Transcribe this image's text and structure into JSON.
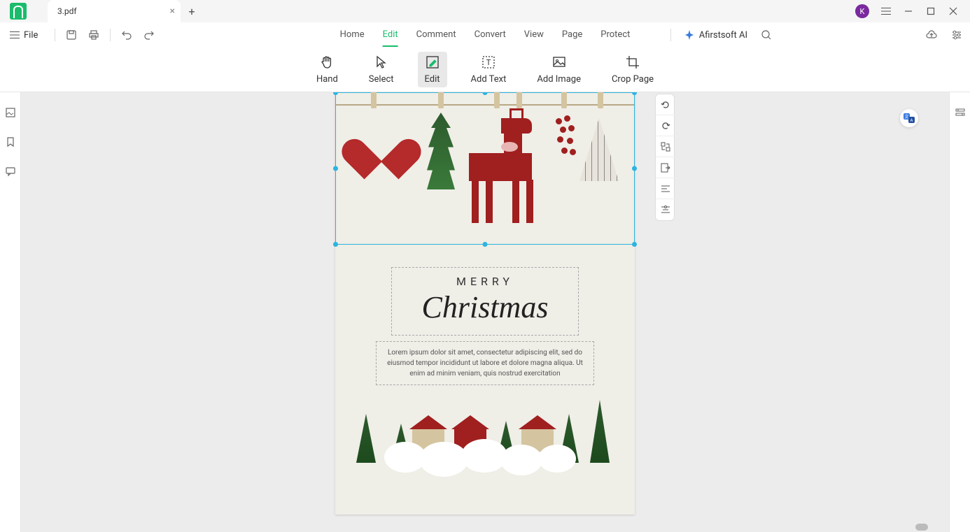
{
  "titlebar": {
    "tab_name": "3.pdf",
    "avatar_letter": "K"
  },
  "menubar": {
    "file_label": "File",
    "items": [
      "Home",
      "Edit",
      "Comment",
      "Convert",
      "View",
      "Page",
      "Protect"
    ],
    "active_index": 1,
    "ai_label": "Afirstsoft AI"
  },
  "toolbar": {
    "tools": [
      "Hand",
      "Select",
      "Edit",
      "Add Text",
      "Add Image",
      "Crop Page"
    ],
    "active_index": 2
  },
  "document": {
    "merry": "MERRY",
    "christmas": "Christmas",
    "body": "Lorem ipsum dolor sit amet, consectetur adipiscing elit, sed do eiusmod tempor incididunt ut labore et dolore magna aliqua. Ut enim ad minim veniam, quis nostrud exercitation"
  }
}
